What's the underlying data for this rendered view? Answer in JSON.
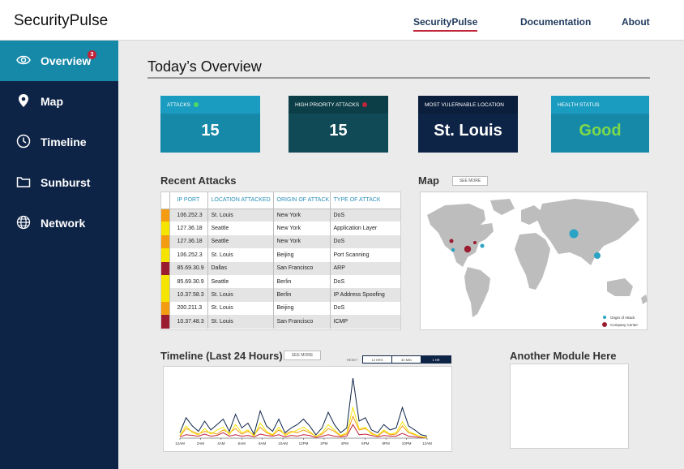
{
  "header": {
    "brand": "SecurityPulse",
    "nav": [
      "SecurityPulse",
      "Documentation",
      "About"
    ]
  },
  "sidebar": {
    "items": [
      {
        "label": "Overview",
        "icon": "eye-icon",
        "badge": "3"
      },
      {
        "label": "Map",
        "icon": "map-pin-icon"
      },
      {
        "label": "Timeline",
        "icon": "clock-icon"
      },
      {
        "label": "Sunburst",
        "icon": "folder-icon"
      },
      {
        "label": "Network",
        "icon": "globe-icon"
      }
    ]
  },
  "page": {
    "title": "Today’s Overview"
  },
  "cards": [
    {
      "label": "ATTACKS",
      "value": "15",
      "color": "#1789a8",
      "dot": "#4cd964"
    },
    {
      "label": "HIGH PRIORITY ATTACKS",
      "value": "15",
      "color": "#0f4a56",
      "dot": "#c0253a"
    },
    {
      "label": "MOST VULERNABLE LOCATION",
      "value": "St. Louis",
      "color": "#0e2447"
    },
    {
      "label": "HEALTH STATUS",
      "value": "Good",
      "color": "#1789a8",
      "value_color": "#7dd94a"
    }
  ],
  "recent": {
    "title": "Recent Attacks",
    "columns": [
      "IP PORT",
      "LOCATION ATTACKED",
      "ORIGIN OF ATTACK",
      "TYPE OF ATTACK"
    ],
    "rows": [
      {
        "ip": "106.252.3",
        "loc": "St. Louis",
        "origin": "New York",
        "type": "DoS",
        "sev": "#f39c12"
      },
      {
        "ip": "127.36.18",
        "loc": "Seattle",
        "origin": "New York",
        "type": "Application Layer",
        "sev": "#f5e400"
      },
      {
        "ip": "127.36.18",
        "loc": "Seattle",
        "origin": "New York",
        "type": "DoS",
        "sev": "#f39c12"
      },
      {
        "ip": "106.252.3",
        "loc": "St. Louis",
        "origin": "Beijing",
        "type": "Port Scanning",
        "sev": "#f5e400"
      },
      {
        "ip": "85.69.30.9",
        "loc": "Dallas",
        "origin": "San Francisco",
        "type": "ARP",
        "sev": "#9b1b30"
      },
      {
        "ip": "85.69.30.9",
        "loc": "Seattle",
        "origin": "Berlin",
        "type": "DoS",
        "sev": "#f5e400"
      },
      {
        "ip": "10.37.58.3",
        "loc": "St. Louis",
        "origin": "Berlin",
        "type": "IP Address Spoofing",
        "sev": "#f5e400"
      },
      {
        "ip": "200.211.3",
        "loc": "St. Louis",
        "origin": "Beijing",
        "type": "DoS",
        "sev": "#f39c12"
      },
      {
        "ip": "10.37.48.3",
        "loc": "St. Louis",
        "origin": "San Francisco",
        "type": "ICMP",
        "sev": "#9b1b30"
      }
    ]
  },
  "map": {
    "title": "Map",
    "see_more": "SEE MORE",
    "legend": [
      "Origin of Attack",
      "Company Center"
    ]
  },
  "timeline": {
    "title": "Timeline (Last 24 Hours)",
    "see_more": "SEE MORE",
    "reset": "RESET",
    "ranges": [
      "12 HRS",
      "30 MIN",
      "1 HR"
    ],
    "active_range": "1 HR"
  },
  "other": {
    "title": "Another Module Here"
  },
  "chart_data": {
    "type": "line",
    "x": [
      "12AM",
      "2AM",
      "4AM",
      "6AM",
      "8AM",
      "10AM",
      "12PM",
      "2PM",
      "4PM",
      "6PM",
      "8PM",
      "10PM",
      "12AM"
    ],
    "series": [
      {
        "color": "#0e2447",
        "values": [
          8,
          30,
          18,
          10,
          25,
          12,
          20,
          28,
          10,
          35,
          15,
          22,
          6,
          40,
          18,
          10,
          28,
          8,
          15,
          20,
          28,
          18,
          5,
          15,
          38,
          20,
          8,
          15,
          88,
          25,
          30,
          12,
          8,
          20,
          12,
          15,
          45,
          18,
          12,
          5,
          3
        ]
      },
      {
        "color": "#f5e400",
        "values": [
          4,
          18,
          8,
          5,
          14,
          6,
          12,
          16,
          5,
          20,
          8,
          12,
          3,
          22,
          10,
          5,
          16,
          4,
          8,
          12,
          16,
          10,
          2,
          8,
          20,
          12,
          4,
          8,
          45,
          14,
          16,
          6,
          4,
          12,
          6,
          8,
          24,
          10,
          6,
          2,
          1
        ]
      },
      {
        "color": "#f39c12",
        "values": [
          3,
          14,
          10,
          6,
          10,
          8,
          6,
          12,
          8,
          14,
          6,
          10,
          5,
          16,
          8,
          4,
          12,
          6,
          10,
          8,
          12,
          8,
          3,
          6,
          14,
          10,
          3,
          6,
          32,
          12,
          14,
          8,
          3,
          10,
          5,
          6,
          18,
          8,
          5,
          2,
          1
        ]
      },
      {
        "color": "#c0253a",
        "values": [
          2,
          5,
          4,
          3,
          6,
          3,
          4,
          8,
          3,
          5,
          3,
          4,
          2,
          6,
          4,
          3,
          5,
          2,
          4,
          3,
          5,
          4,
          1,
          3,
          5,
          3,
          2,
          3,
          20,
          5,
          6,
          4,
          2,
          4,
          3,
          3,
          7,
          3,
          2,
          1,
          1
        ]
      }
    ],
    "ylim": [
      0,
      100
    ]
  }
}
